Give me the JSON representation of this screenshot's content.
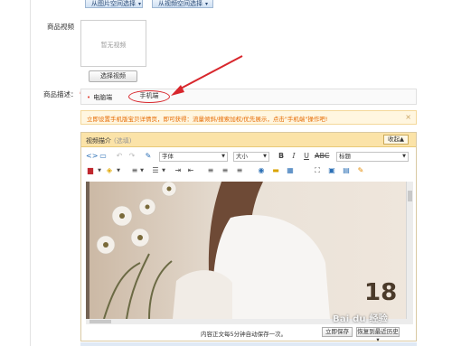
{
  "top_buttons": [
    {
      "label": "从图片空间选择",
      "caret": "▾"
    },
    {
      "label": "从视频空间选择",
      "caret": "▾"
    }
  ],
  "video": {
    "label": "商品视频",
    "placeholder": "暂无视频",
    "select_button": "选择视频"
  },
  "description": {
    "label": "商品描述：",
    "required_mark": "*",
    "tabs": {
      "pc": "电脑端",
      "mobile": "手机端"
    }
  },
  "notice": {
    "text": "立即设置手机版宝贝详情页，即可获得：流量倾斜/搜索加权/优先展示，点击\"手机端\"操作吧!",
    "close": "×"
  },
  "editor": {
    "title": "视频描介",
    "subtitle": "(选填)",
    "collapse_button": "收起▲",
    "font_select": "字体",
    "size_select": "大小",
    "heading_select": "标题",
    "footer_hint": "内容正文每5分钟自动保存一次。",
    "save_button": "立即保存",
    "restore_button": "恢复到最近历史▾",
    "image_number": "18"
  },
  "watermark": "Bai du 经验",
  "colors": {
    "accent_red": "#d8262c",
    "notice_orange": "#e66a00",
    "editor_header": "#fbe3a8",
    "link_blue": "#2a4a75"
  }
}
